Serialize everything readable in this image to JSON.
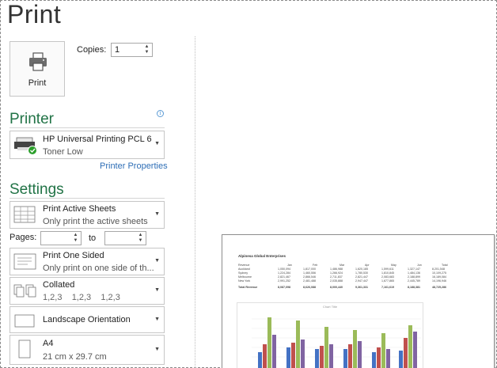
{
  "title": "Print",
  "print_button": {
    "label": "Print",
    "icon": "printer-icon"
  },
  "copies": {
    "label": "Copies:",
    "value": "1"
  },
  "printer": {
    "heading": "Printer",
    "name": "HP Universal Printing PCL 6",
    "status": "Toner Low",
    "properties_link": "Printer Properties",
    "info_icon": "i"
  },
  "settings": {
    "heading": "Settings",
    "items": [
      {
        "title": "Print Active Sheets",
        "subtitle": "Only print the active sheets",
        "icon": "sheets-icon"
      },
      {
        "title": "Print One Sided",
        "subtitle": "Only print on one side of th...",
        "icon": "one-sided-icon"
      },
      {
        "title": "Collated",
        "subtitle": "1,2,3    1,2,3    1,2,3",
        "icon": "collated-icon"
      },
      {
        "title": "Landscape Orientation",
        "subtitle": "",
        "icon": "landscape-icon"
      },
      {
        "title": "A4",
        "subtitle": "21 cm x 29.7 cm",
        "icon": "paper-icon"
      }
    ],
    "pages_label": "Pages:",
    "to_label": "to",
    "pages_from": "",
    "pages_to": ""
  },
  "preview": {
    "title": "Alpinesa Global Enterprises",
    "header": [
      "Revenue",
      "Jan",
      "Feb",
      "Mar",
      "Apr",
      "May",
      "Jun",
      "Total"
    ],
    "rows": [
      [
        "Auckland",
        "1,050,094",
        "1,817,000",
        "1,486,988",
        "1,620,185",
        "1,599,611",
        "1,327,147",
        "8,201,548"
      ],
      [
        "Sydney",
        "1,224,284",
        "1,460,556",
        "1,266,924",
        "1,780,530",
        "1,810,845",
        "1,484,136",
        "10,109,275"
      ],
      [
        "Melbourne",
        "2,821,467",
        "2,866,546",
        "2,711,837",
        "2,821,447",
        "2,083,683",
        "2,188,899",
        "16,189,084"
      ],
      [
        "New York",
        "2,991,252",
        "2,481,488",
        "2,035,888",
        "2,947,447",
        "1,677,865",
        "2,445,789",
        "14,196,946"
      ]
    ],
    "total_row": [
      "Total Revenue",
      "8,087,098",
      "8,626,088",
      "8,000,440",
      "9,361,331",
      "7,161,619",
      "8,188,381",
      "48,725,286"
    ],
    "chart_label": "Chart Title"
  },
  "colors": {
    "accent": "#217346",
    "link": "#2e6eb6"
  }
}
